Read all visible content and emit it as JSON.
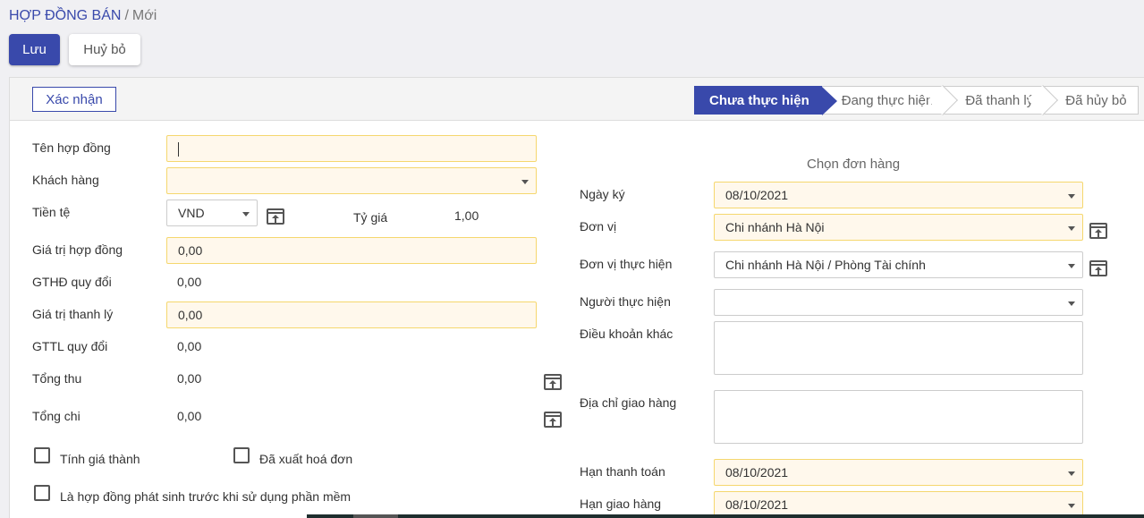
{
  "breadcrumb": {
    "root": "HỢP ĐỒNG BÁN",
    "separator": "/",
    "current": "Mới"
  },
  "toolbar": {
    "save_label": "Lưu",
    "discard_label": "Huỷ bỏ"
  },
  "statusbar": {
    "confirm_label": "Xác nhận",
    "stages": [
      "Chưa thực hiện",
      "Đang thực hiện",
      "Đã thanh lý",
      "Đã hủy bỏ"
    ],
    "active_stage": "Chưa thực hiện"
  },
  "left": {
    "contract_name_label": "Tên hợp đồng",
    "contract_name_value": "",
    "customer_label": "Khách hàng",
    "customer_value": "",
    "currency_label": "Tiền tệ",
    "currency_value": "VND",
    "rate_label": "Tỷ giá",
    "rate_value": "1,00",
    "contract_value_label": "Giá trị hợp đồng",
    "contract_value": "0,00",
    "gthd_label": "GTHĐ quy đổi",
    "gthd_value": "0,00",
    "liquidation_label": "Giá trị thanh lý",
    "liquidation_value": "0,00",
    "gttl_label": "GTTL quy đổi",
    "gttl_value": "0,00",
    "total_in_label": "Tổng thu",
    "total_in_value": "0,00",
    "total_out_label": "Tổng chi",
    "total_out_value": "0,00",
    "cost_calc_label": "Tính giá thành",
    "invoiced_label": "Đã xuất hoá đơn",
    "pre_software_label": "Là hợp đồng phát sinh trước khi sử dụng phần mềm"
  },
  "right": {
    "select_order_label": "Chọn đơn hàng",
    "sign_date_label": "Ngày ký",
    "sign_date_value": "08/10/2021",
    "unit_label": "Đơn vị",
    "unit_value": "Chi nhánh Hà Nội",
    "exec_unit_label": "Đơn vị thực hiện",
    "exec_unit_value": "Chi nhánh Hà Nội / Phòng Tài chính",
    "executor_label": "Người thực hiện",
    "executor_value": "",
    "other_terms_label": "Điều khoản khác",
    "delivery_address_label": "Địa chỉ giao hàng",
    "payment_deadline_label": "Hạn thanh toán",
    "payment_deadline_value": "08/10/2021",
    "delivery_deadline_label": "Hạn giao hàng",
    "delivery_deadline_value": "08/10/2021"
  }
}
